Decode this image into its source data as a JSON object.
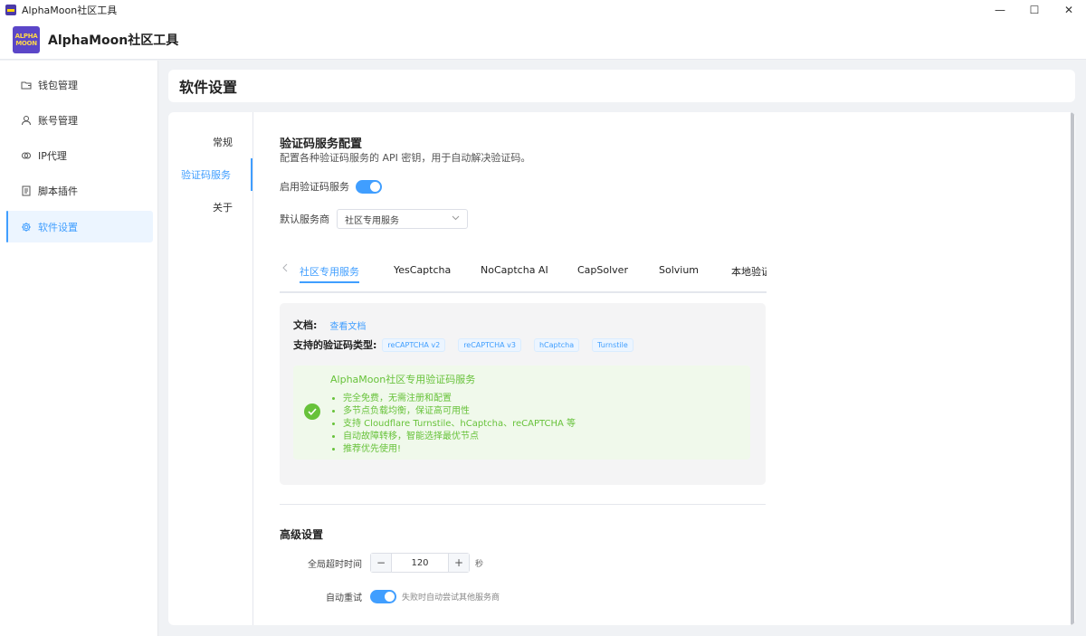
{
  "window": {
    "title": "AlphaMoon社区工具",
    "minimize": "—",
    "maximize": "☐",
    "close": "✕"
  },
  "header": {
    "logo_line1": "ALPHA",
    "logo_line2": "MOON",
    "app_name": "AlphaMoon社区工具"
  },
  "sidebar": {
    "items": [
      {
        "label": "钱包管理",
        "icon": "wallet-icon"
      },
      {
        "label": "账号管理",
        "icon": "user-icon"
      },
      {
        "label": "IP代理",
        "icon": "link-icon"
      },
      {
        "label": "脚本插件",
        "icon": "document-icon"
      },
      {
        "label": "软件设置",
        "icon": "gear-icon",
        "active": true
      }
    ]
  },
  "page": {
    "title": "软件设置"
  },
  "settings_menu": {
    "items": [
      {
        "label": "常规"
      },
      {
        "label": "验证码服务",
        "active": true
      },
      {
        "label": "关于"
      }
    ]
  },
  "captcha": {
    "section_title": "验证码服务配置",
    "section_desc": "配置各种验证码服务的 API 密钥，用于自动解决验证码。",
    "enable_label": "启用验证码服务",
    "enable_value": true,
    "default_provider_label": "默认服务商",
    "default_provider_value": "社区专用服务",
    "tabs": [
      {
        "label": "社区专用服务",
        "active": true
      },
      {
        "label": "YesCaptcha"
      },
      {
        "label": "NoCaptcha AI"
      },
      {
        "label": "CapSolver"
      },
      {
        "label": "Solvium"
      },
      {
        "label": "本地验证"
      }
    ],
    "doc_label": "文档:",
    "doc_link": "查看文档",
    "types_label": "支持的验证码类型:",
    "types": [
      "reCAPTCHA v2",
      "reCAPTCHA v3",
      "hCaptcha",
      "Turnstile"
    ],
    "alert": {
      "title": "AlphaMoon社区专用验证码服务",
      "items": [
        "完全免费，无需注册和配置",
        "多节点负载均衡，保证高可用性",
        "支持 Cloudflare Turnstile、hCaptcha、reCAPTCHA 等",
        "自动故障转移，智能选择最优节点",
        "推荐优先使用!"
      ],
      "color": "#67c23a"
    }
  },
  "advanced": {
    "title": "高级设置",
    "timeout_label": "全局超时时间",
    "timeout_value": "120",
    "timeout_unit": "秒",
    "minus": "−",
    "plus": "+",
    "retry_label": "自动重试",
    "retry_value": true,
    "retry_hint": "失败时自动尝试其他服务商"
  },
  "colors": {
    "accent": "#409eff",
    "success": "#67c23a"
  }
}
